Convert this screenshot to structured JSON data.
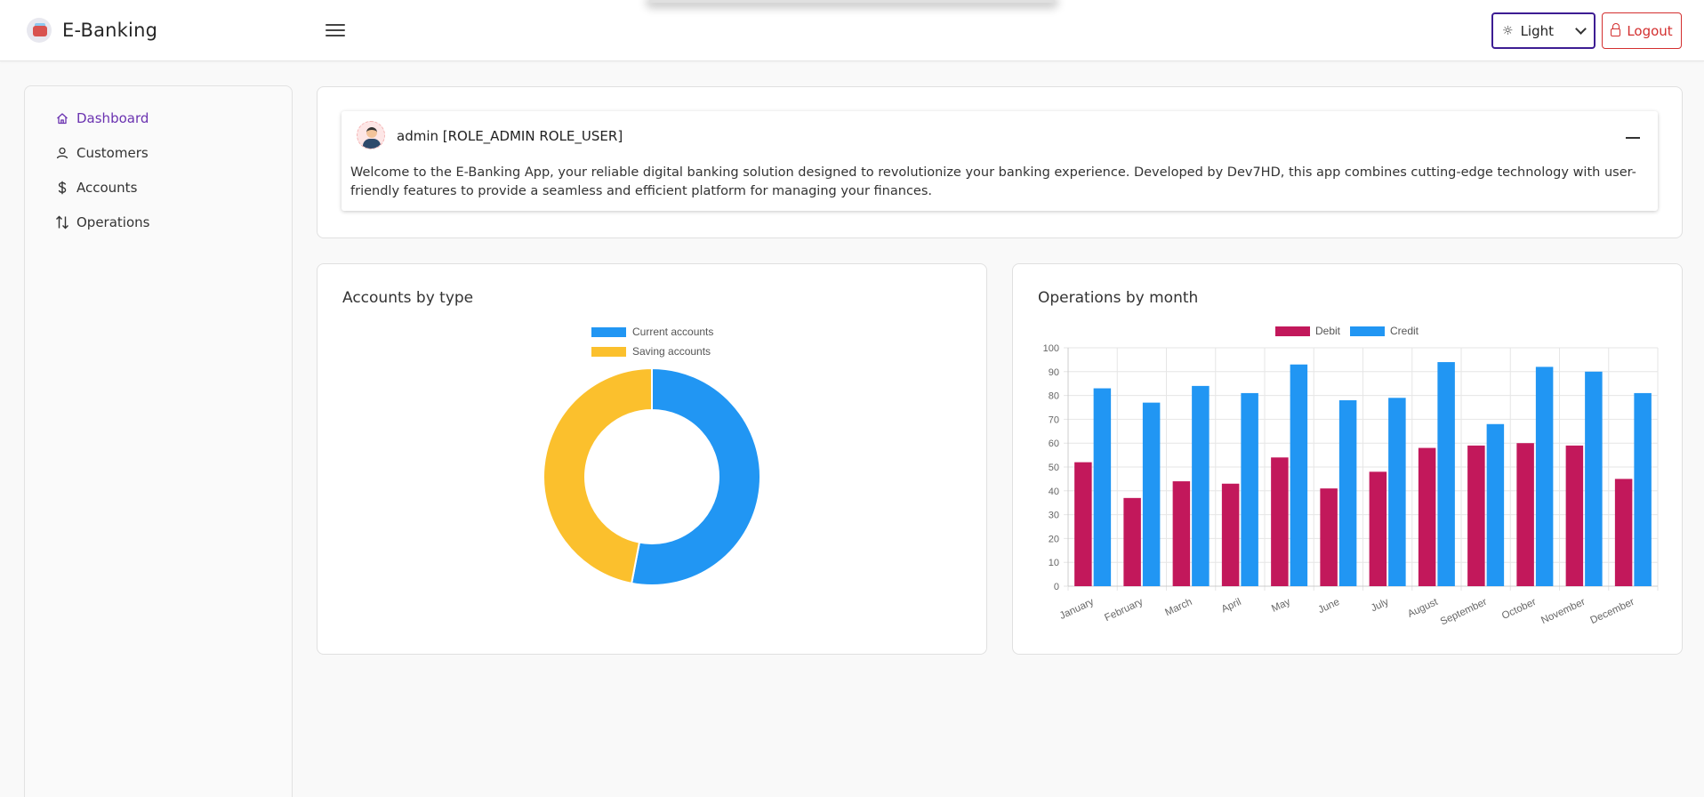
{
  "app": {
    "title": "E-Banking"
  },
  "header": {
    "theme": {
      "label": "Light",
      "icon": "sun-icon"
    },
    "logout_label": "Logout"
  },
  "sidebar": {
    "items": [
      {
        "label": "Dashboard",
        "icon": "home-icon",
        "active": true
      },
      {
        "label": "Customers",
        "icon": "user-icon",
        "active": false
      },
      {
        "label": "Accounts",
        "icon": "dollar-icon",
        "active": false
      },
      {
        "label": "Operations",
        "icon": "arrows-updown-icon",
        "active": false
      }
    ]
  },
  "welcome": {
    "user": "admin [ROLE_ADMIN ROLE_USER]",
    "text": "Welcome to the E-Banking App, your reliable digital banking solution designed to revolutionize your banking experience. Developed by Dev7HD, this app combines cutting-edge technology with user-friendly features to provide a seamless and efficient platform for managing your finances."
  },
  "colors": {
    "accent": "#6a32b0",
    "current_accounts": "#2196f3",
    "saving_accounts": "#fbc02d",
    "debit": "#c2185b",
    "credit": "#2196f3",
    "logout": "#d32f2f"
  },
  "chart_data": [
    {
      "type": "pie",
      "title": "Accounts by type",
      "variant": "doughnut",
      "labels": [
        "Current accounts",
        "Saving accounts"
      ],
      "values": [
        53,
        47
      ],
      "colors": [
        "#2196f3",
        "#fbc02d"
      ],
      "legend": "top"
    },
    {
      "type": "bar",
      "title": "Operations by month",
      "categories": [
        "January",
        "February",
        "March",
        "April",
        "May",
        "June",
        "July",
        "August",
        "September",
        "October",
        "November",
        "December"
      ],
      "series": [
        {
          "name": "Debit",
          "color": "#c2185b",
          "values": [
            52,
            37,
            44,
            43,
            54,
            41,
            48,
            58,
            59,
            60,
            59,
            45
          ]
        },
        {
          "name": "Credit",
          "color": "#2196f3",
          "values": [
            83,
            77,
            84,
            81,
            93,
            78,
            79,
            94,
            68,
            92,
            90,
            81
          ]
        }
      ],
      "ylim": [
        0,
        100
      ],
      "yticks": [
        0,
        10,
        20,
        30,
        40,
        50,
        60,
        70,
        80,
        90,
        100
      ],
      "grid": true,
      "legend": "top"
    }
  ]
}
